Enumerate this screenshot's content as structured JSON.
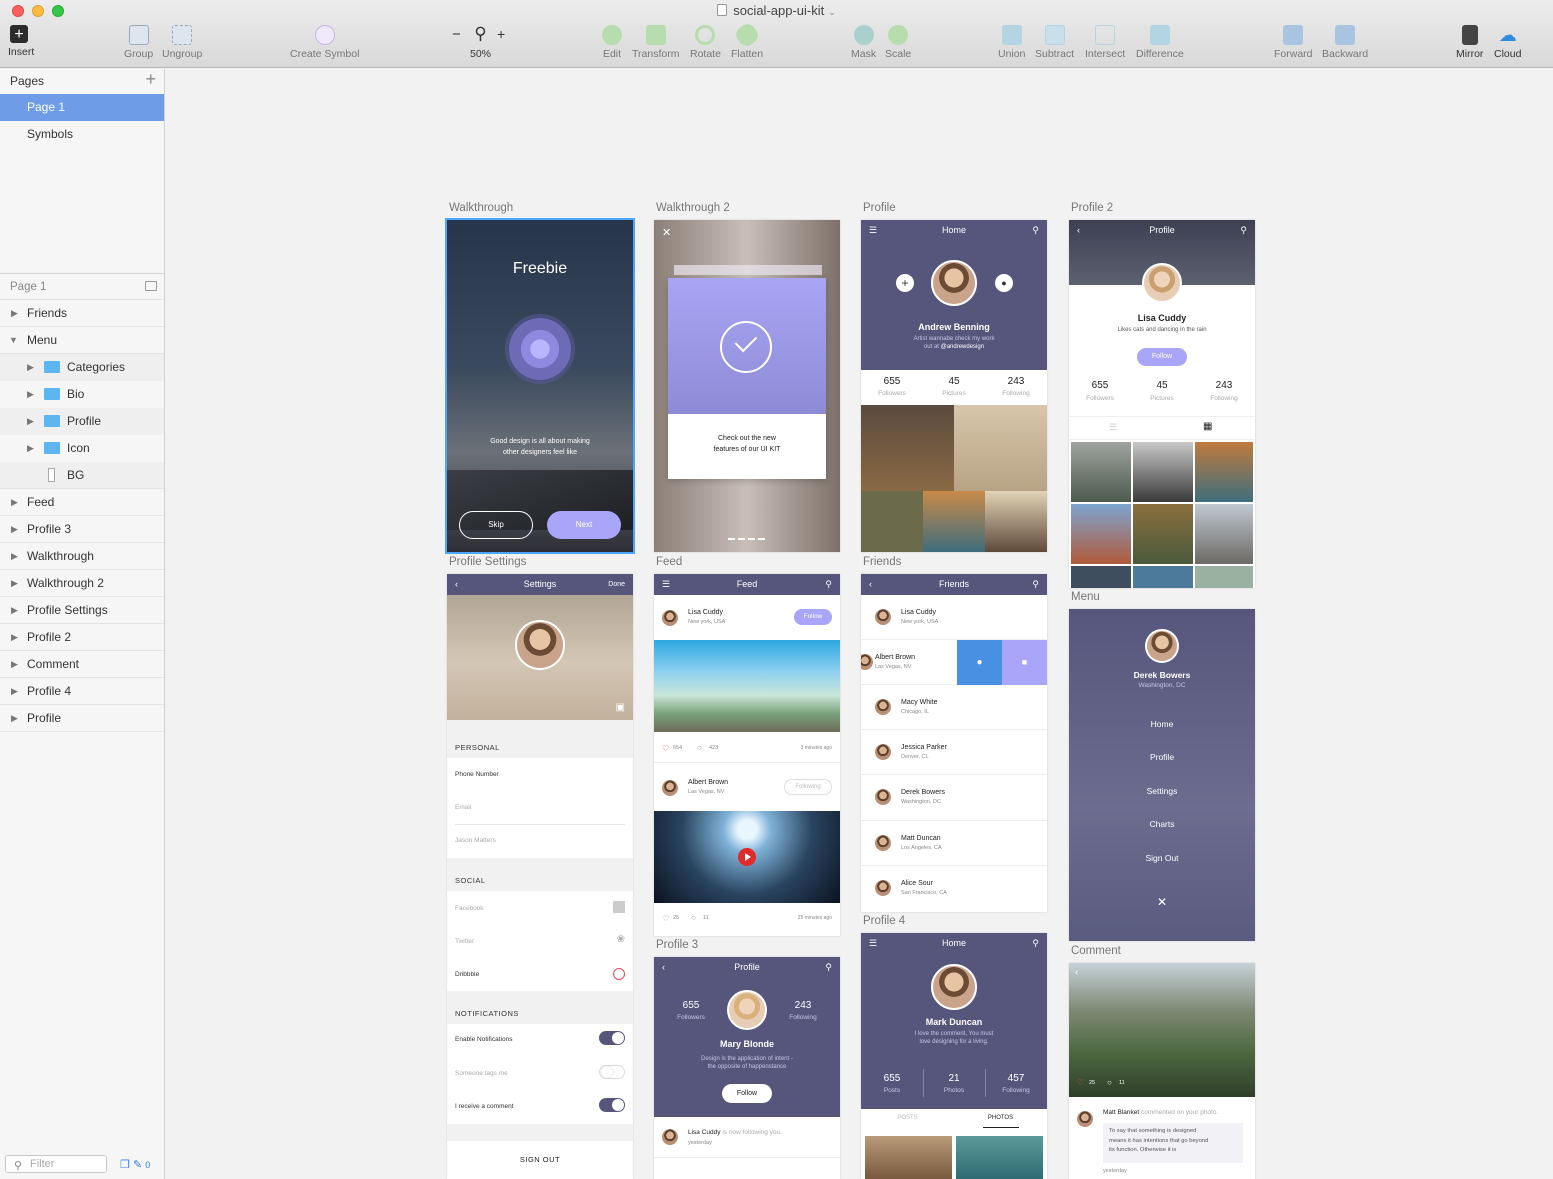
{
  "window": {
    "title": "social-app-ui-kit"
  },
  "toolbar": {
    "insert": "Insert",
    "group": "Group",
    "ungroup": "Ungroup",
    "create_symbol": "Create Symbol",
    "zoom_minus": "−",
    "zoom_plus": "+",
    "zoom": "50%",
    "edit": "Edit",
    "transform": "Transform",
    "rotate": "Rotate",
    "flatten": "Flatten",
    "mask": "Mask",
    "scale": "Scale",
    "union": "Union",
    "subtract": "Subtract",
    "intersect": "Intersect",
    "difference": "Difference",
    "forward": "Forward",
    "backward": "Backward",
    "mirror": "Mirror",
    "cloud": "Cloud"
  },
  "sidebar": {
    "pages_title": "Pages",
    "pages_add": "+",
    "pages": [
      "Page 1",
      "Symbols"
    ],
    "layers_title": "Page 1",
    "layers": [
      "Friends",
      "Menu",
      "Categories",
      "Bio",
      "Profile",
      "Icon",
      "BG",
      "Feed",
      "Profile 3",
      "Walkthrough",
      "Walkthrough 2",
      "Profile Settings",
      "Profile 2",
      "Comment",
      "Profile 4",
      "Profile"
    ],
    "filter_placeholder": "Filter",
    "filter_count": "0"
  },
  "artboards": {
    "walkthrough": {
      "label": "Walkthrough",
      "title": "Freebie",
      "text1": "Good design is all about making",
      "text2": "other designers feel like",
      "skip": "Skip",
      "next": "Next"
    },
    "walkthrough2": {
      "label": "Walkthrough 2",
      "close": "✕",
      "text1": "Check out the new",
      "text2": "features of our UI KIT"
    },
    "profile": {
      "label": "Profile",
      "bar": "Home",
      "name": "Andrew Benning",
      "bio1": "Artist wannabe check my work",
      "bio2": "out at",
      "handle": "@andrewdesign",
      "stats": [
        {
          "n": "655",
          "l": "Followers"
        },
        {
          "n": "45",
          "l": "Pictures"
        },
        {
          "n": "243",
          "l": "Following"
        }
      ]
    },
    "profile2": {
      "label": "Profile 2",
      "bar": "Profile",
      "name": "Lisa Cuddy",
      "bio": "Likes cats and dancing in the rain",
      "follow": "Follow",
      "stats": [
        {
          "n": "655",
          "l": "Followers"
        },
        {
          "n": "45",
          "l": "Pictures"
        },
        {
          "n": "243",
          "l": "Following"
        }
      ]
    },
    "settings": {
      "label": "Profile Settings",
      "bar": "Settings",
      "done": "Done",
      "personal": "PERSONAL",
      "phone": "Phone Number",
      "email": "Email",
      "name": "Jason Matters",
      "social": "SOCIAL",
      "facebook": "Facebook",
      "twitter": "Twitter",
      "dribbble": "Dribbble",
      "notifications": "NOTIFICATIONS",
      "enable": "Enable Notifications",
      "tags": "Someone tags me",
      "comment": "I receive a comment",
      "signout": "SIGN OUT"
    },
    "feed": {
      "label": "Feed",
      "bar": "Feed",
      "user1": "Lisa Cuddy",
      "loc1": "New york, USA",
      "follow": "Follow",
      "likes1": "654",
      "comments1": "423",
      "time1": "3 minutes ago",
      "user2": "Albert Brown",
      "loc2": "Las Vegas, NV",
      "following": "Following",
      "likes2": "25",
      "comments2": "11",
      "time2": "25 minutes ago"
    },
    "friends": {
      "label": "Friends",
      "bar": "Friends",
      "people": [
        {
          "name": "Lisa Cuddy",
          "loc": "New york, USA"
        },
        {
          "name": "Albert Brown",
          "loc": "Las Vegas, NV"
        },
        {
          "name": "Macy White",
          "loc": "Chicago, IL"
        },
        {
          "name": "Jessica Parker",
          "loc": "Denver, CL"
        },
        {
          "name": "Derek Bowers",
          "loc": "Washington, DC"
        },
        {
          "name": "Matt Duncan",
          "loc": "Los Angeles, CA"
        },
        {
          "name": "Alice Sour",
          "loc": "San Francisco, CA"
        }
      ]
    },
    "menu": {
      "label": "Menu",
      "name": "Derek Bowers",
      "loc": "Washington, DC",
      "items": [
        "Home",
        "Profile",
        "Settings",
        "Charts",
        "Sign Out"
      ],
      "close": "✕"
    },
    "profile3": {
      "label": "Profile 3",
      "bar": "Profile",
      "name": "Mary Blonde",
      "bio1": "Design is the application of intent -",
      "bio2": "the opposite of happenstance",
      "follow": "Follow",
      "followers_n": "655",
      "followers_l": "Followers",
      "following_n": "243",
      "following_l": "Following",
      "activity_user": "Lisa Cuddy",
      "activity_text": "is now following you.",
      "activity_time": "yesterday"
    },
    "profile4": {
      "label": "Profile 4",
      "bar": "Home",
      "name": "Mark Duncan",
      "bio1": "I love the comment, You must",
      "bio2": "love designing for a living.",
      "stats": [
        {
          "n": "655",
          "l": "Posts"
        },
        {
          "n": "21",
          "l": "Photos"
        },
        {
          "n": "457",
          "l": "Following"
        }
      ],
      "tab1": "POSTS",
      "tab2": "PHOTOS"
    },
    "comment": {
      "label": "Comment",
      "likes": "25",
      "comments": "11",
      "user": "Matt Blanket",
      "action": "commented on your photo.",
      "text1": "To say that something is designed",
      "text2": "means it has intentions that go beyond",
      "text3": "its function. Otherwise it is",
      "time": "yesterday"
    }
  },
  "colors": {
    "accent": "#a9a5f9",
    "mauve": "#56557c",
    "selection": "#6f9ce6",
    "heart": "#e4465a"
  }
}
